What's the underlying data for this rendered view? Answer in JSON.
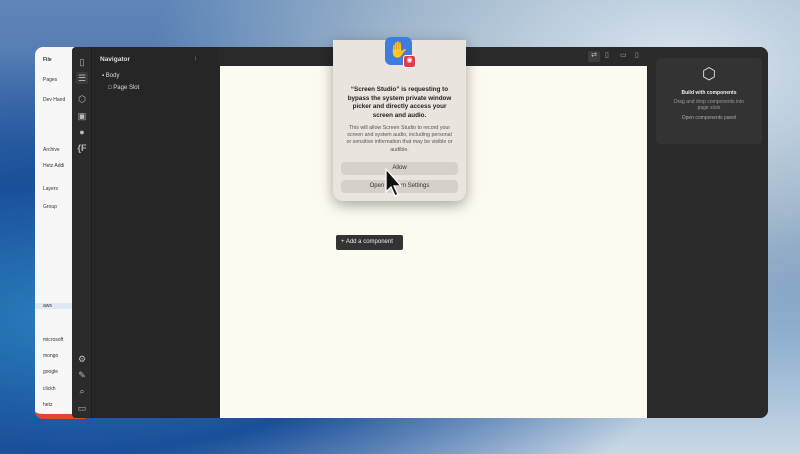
{
  "back_window": {
    "menu": "File",
    "items": [
      "Pages",
      "Dev Hand",
      "Archive",
      "Hetz Addi",
      "Layers",
      "Group",
      "aws",
      "microsoft",
      "mongo",
      "google",
      "clickh",
      "hetz"
    ]
  },
  "navigator": {
    "title": "Navigator",
    "tree": [
      {
        "label": "Body"
      },
      {
        "label": "Page Slot"
      }
    ]
  },
  "canvas": {
    "add_component": "Add a component"
  },
  "right_panel": {
    "title": "Build with components",
    "description": "Drag and drop components into page slots",
    "link": "Open components panel"
  },
  "dialog": {
    "title": "“Screen Studio” is requesting to bypass the system private window picker and directly access your screen and audio.",
    "body": "This will allow Screen Studio to record your screen and system audio, including personal or sensitive information that may be visible or audible.",
    "allow": "Allow",
    "open_settings": "Open System Settings"
  }
}
